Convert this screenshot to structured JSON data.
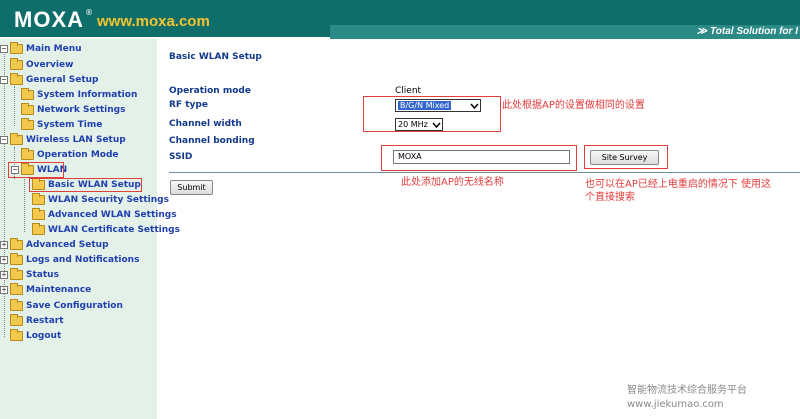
{
  "header": {
    "logo_text": "MOXA",
    "logo_reg": "®",
    "logo_url": "www.moxa.com",
    "tagline": "≫ Total Solution for I"
  },
  "sidebar": {
    "items": {
      "main_menu": "Main Menu",
      "overview": "Overview",
      "general_setup": "General Setup",
      "system_information": "System Information",
      "network_settings": "Network Settings",
      "system_time": "System Time",
      "wireless_lan_setup": "Wireless LAN Setup",
      "operation_mode": "Operation Mode",
      "wlan": "WLAN",
      "basic_wlan_setup": "Basic WLAN Setup",
      "wlan_security_settings": "WLAN Security Settings",
      "advanced_wlan_settings": "Advanced WLAN Settings",
      "wlan_certificate_settings": "WLAN Certificate Settings",
      "advanced_setup": "Advanced Setup",
      "logs_and_notifications": "Logs and Notifications",
      "status": "Status",
      "maintenance": "Maintenance",
      "save_configuration": "Save Configuration",
      "restart": "Restart",
      "logout": "Logout"
    },
    "expander_plus": "+",
    "expander_minus": "−"
  },
  "main": {
    "title": "Basic WLAN Setup",
    "operation_mode": {
      "label": "Operation mode",
      "value": "Client"
    },
    "rf_type": {
      "label": "RF type",
      "value": "B/G/N Mixed"
    },
    "channel_width": {
      "label": "Channel width",
      "value": "20 MHz"
    },
    "channel_bonding": {
      "label": "Channel bonding"
    },
    "ssid": {
      "label": "SSID",
      "value": "MOXA"
    },
    "site_survey_label": "Site Survey",
    "submit_label": "Submit"
  },
  "annotations": {
    "rf_note": "此处根据AP的设置做相同的设置",
    "ssid_note": "此处添加AP的无线名称",
    "survey_note_line1": "也可以在AP已经上电重启的情况下 使用这",
    "survey_note_line2": "个直接搜索"
  },
  "watermark": {
    "line1": "智能物流技术综合服务平台",
    "line2": "www.jiekumao.com"
  },
  "colors": {
    "header_bg": "#0f6e69",
    "logo_url": "#f4c430",
    "sidebar_bg": "#e3f1e9",
    "link_blue": "#1f3fae",
    "label_blue": "#123a8c",
    "annotation_red": "#e23b3b"
  },
  "icons": {
    "folder": "folder-icon",
    "expander": "tree-expander-icon",
    "dropdown": "chevron-down-icon"
  }
}
